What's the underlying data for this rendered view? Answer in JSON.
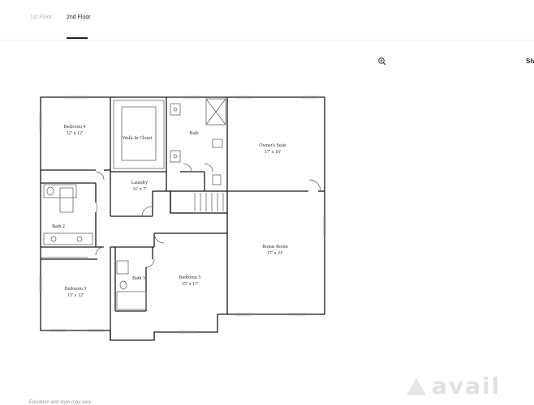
{
  "tabs": [
    {
      "label": "1st Floor",
      "active": false
    },
    {
      "label": "2nd Floor",
      "active": true
    }
  ],
  "toolbar": {
    "zoom_icon": "zoom-in-icon",
    "share_label": "Sh"
  },
  "rooms": {
    "bedroom4": {
      "name": "Bedroom 4",
      "size": "12' x 12'"
    },
    "walk_in_closet": {
      "name": "Walk-In Closet"
    },
    "bath": {
      "name": "Bath"
    },
    "owners_suite": {
      "name": "Owner's Suite",
      "size": "17' x 16'"
    },
    "laundry": {
      "name": "Laundry",
      "size": "11' x 7'"
    },
    "bath2": {
      "name": "Bath 2"
    },
    "bonus_room": {
      "name": "Bonus Room",
      "size": "17' x 21'"
    },
    "bath3": {
      "name": "Bath 3"
    },
    "bedroom5": {
      "name": "Bedroom 5",
      "size": "15' x 17'"
    },
    "bedroom3": {
      "name": "Bedroom 3",
      "size": "13' x 12'"
    }
  },
  "watermark": {
    "text": "avail"
  },
  "footer": {
    "note": "Elevation and style may vary"
  },
  "colors": {
    "wall": "#1a1a1a",
    "fixture": "#555555",
    "tab_active": "#222222",
    "tab_inactive": "#b5b5b5"
  }
}
